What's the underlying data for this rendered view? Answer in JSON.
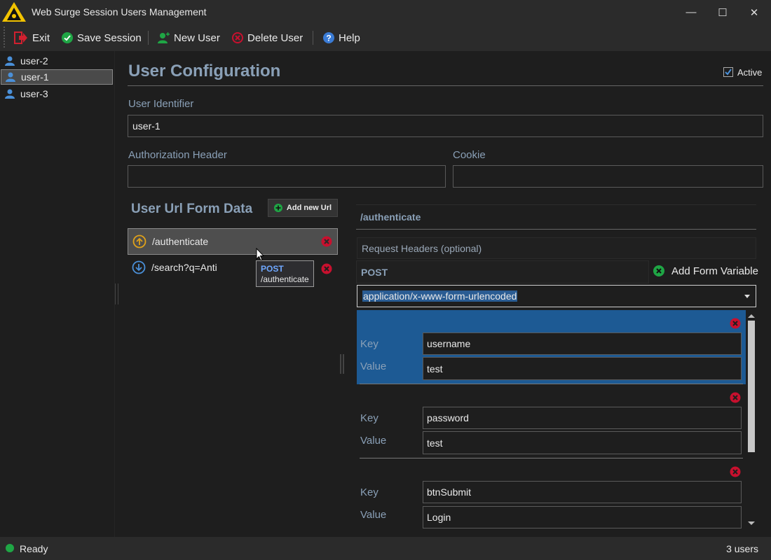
{
  "window": {
    "title": "Web Surge Session Users Management",
    "controls": {
      "minimize": "—",
      "maximize": "☐",
      "close": "✕"
    }
  },
  "toolbar": {
    "exit_label": "Exit",
    "save_label": "Save Session",
    "new_user_label": "New User",
    "delete_user_label": "Delete User",
    "help_label": "Help"
  },
  "sidebar": {
    "users": [
      {
        "label": "user-2",
        "selected": false
      },
      {
        "label": "user-1",
        "selected": true
      },
      {
        "label": "user-3",
        "selected": false
      }
    ]
  },
  "config": {
    "heading": "User Configuration",
    "active_label": "Active",
    "active_checked": true,
    "user_identifier_label": "User Identifier",
    "user_identifier_value": "user-1",
    "auth_header_label": "Authorization Header",
    "auth_header_value": "",
    "cookie_label": "Cookie",
    "cookie_value": ""
  },
  "urlform": {
    "title": "User Url Form Data",
    "add_button_label": "Add new Url",
    "urls": [
      {
        "label": "/authenticate",
        "method": "POST",
        "selected": true
      },
      {
        "label": "/search?q=Anti",
        "method": "GET",
        "selected": false
      }
    ],
    "tooltip": {
      "method": "POST",
      "url": "/authenticate"
    }
  },
  "detail": {
    "url_title": "/authenticate",
    "request_headers_placeholder": "Request Headers (optional)",
    "method": "POST",
    "add_form_variable_label": "Add Form Variable",
    "content_type": "application/x-www-form-urlencoded",
    "key_label": "Key",
    "value_label": "Value",
    "variables": [
      {
        "key": "username",
        "value": "test",
        "selected": true
      },
      {
        "key": "password",
        "value": "test",
        "selected": false
      },
      {
        "key": "btnSubmit",
        "value": "Login",
        "selected": false
      }
    ]
  },
  "status": {
    "text": "Ready",
    "count": "3 users"
  },
  "colors": {
    "accent_heading": "#8aa0b7",
    "selection_blue": "#1d5a94",
    "delete_red": "#c8102e",
    "ok_green": "#1fa645"
  },
  "icons": {
    "exit": "exit-icon",
    "save": "checkmark-icon",
    "new_user": "add-user-icon",
    "delete_user": "delete-icon",
    "help": "help-icon",
    "user": "user-icon",
    "upload": "arrow-up-circle-icon",
    "download": "arrow-down-circle-icon"
  }
}
